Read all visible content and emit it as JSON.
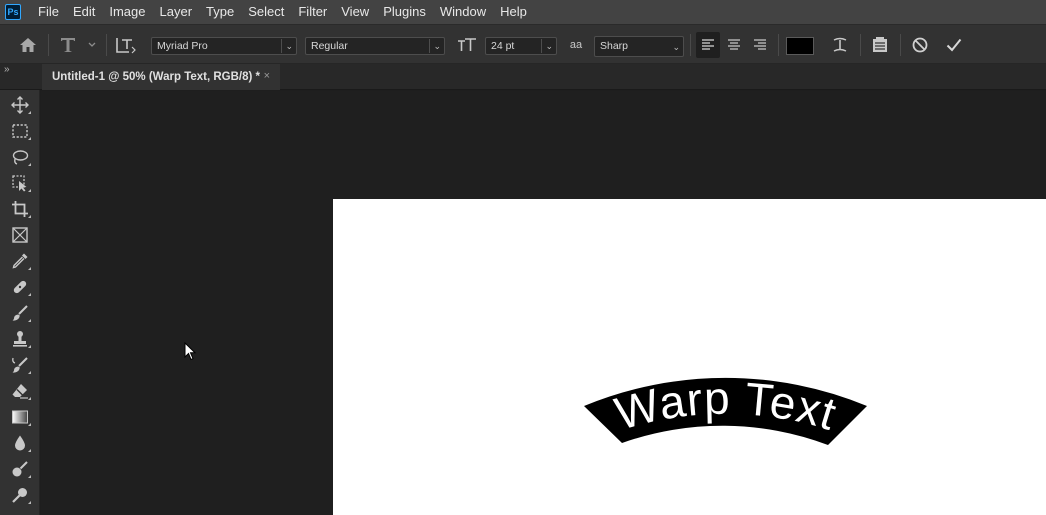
{
  "app": {
    "logo": "Ps"
  },
  "menu": [
    "File",
    "Edit",
    "Image",
    "Layer",
    "Type",
    "Select",
    "Filter",
    "View",
    "Plugins",
    "Window",
    "Help"
  ],
  "options": {
    "font_family": "Myriad Pro",
    "font_style": "Regular",
    "font_size": "24 pt",
    "antialias_icon": "aa",
    "antialias": "Sharp",
    "text_color": "#000000",
    "icons": [
      "home-icon",
      "text-tool-icon",
      "text-orientation-icon",
      "font-size-icon",
      "antialias-icon",
      "align-left-icon",
      "align-center-icon",
      "align-right-icon",
      "warp-text-icon",
      "character-panel-icon",
      "cancel-icon",
      "commit-icon"
    ]
  },
  "tab": {
    "title": "Untitled-1 @ 50% (Warp Text, RGB/8) *",
    "close": "×"
  },
  "document": {
    "text": "Warp Text",
    "background": "#ffffff",
    "warp_fill": "#000000",
    "text_color": "#ffffff"
  },
  "tools": [
    "move-tool-icon",
    "marquee-tool-icon",
    "lasso-tool-icon",
    "object-selection-tool-icon",
    "crop-tool-icon",
    "frame-tool-icon",
    "eyedropper-tool-icon",
    "healing-brush-tool-icon",
    "brush-tool-icon",
    "clone-stamp-tool-icon",
    "history-brush-tool-icon",
    "eraser-tool-icon",
    "gradient-tool-icon",
    "blur-tool-icon",
    "dodge-tool-icon",
    "pen-tool-icon"
  ]
}
